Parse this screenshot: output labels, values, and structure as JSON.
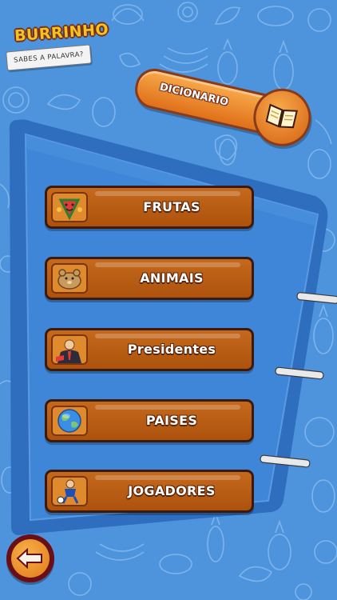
{
  "app": {
    "logo_title": "BURRINHO",
    "logo_subtitle": "SABES A PALAVRA?"
  },
  "dictionary": {
    "label": "DICIONARIO",
    "icon": "book-icon"
  },
  "categories": [
    {
      "label": "FRUTAS",
      "icon": "watermelon-character-icon"
    },
    {
      "label": "ANIMAIS",
      "icon": "hamster-icon"
    },
    {
      "label": "Presidentes",
      "icon": "president-icon"
    },
    {
      "label": "PAISES",
      "icon": "globe-icon"
    },
    {
      "label": "JOGADORES",
      "icon": "soccer-player-icon"
    }
  ],
  "back": {
    "icon": "arrow-left-icon"
  },
  "colors": {
    "background": "#4d94dc",
    "board": "#3f7fd0",
    "button": "#b95a12",
    "button_border": "#3b1a0b",
    "accent_orange": "#f08a24",
    "back_dark": "#6a0f17"
  }
}
